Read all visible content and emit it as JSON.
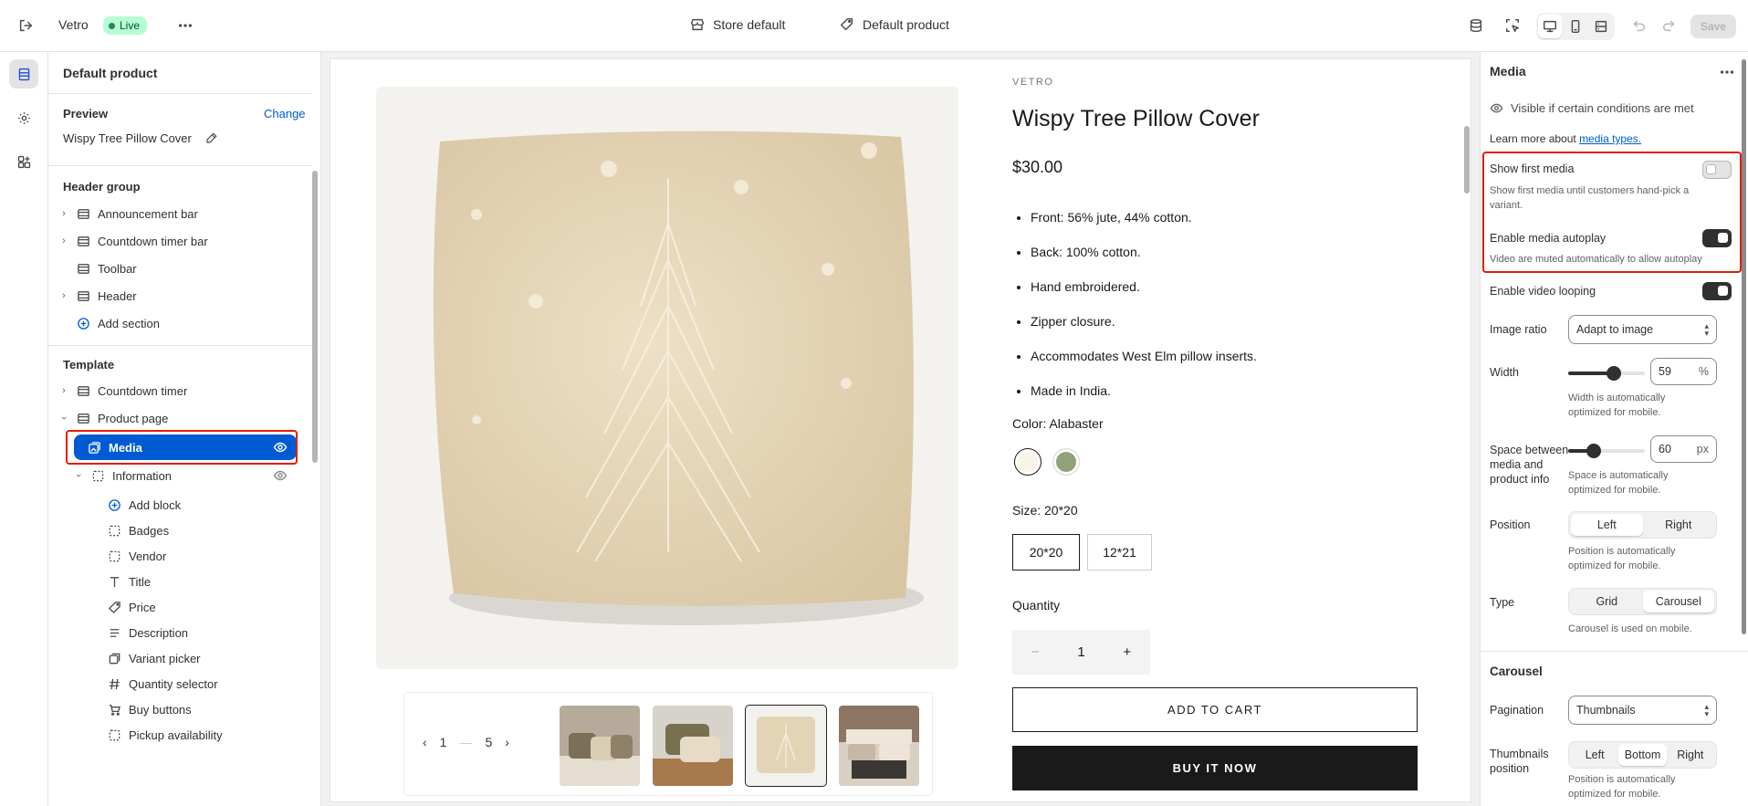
{
  "topbar": {
    "store_name": "Vetro",
    "live_label": "Live",
    "store_default_label": "Store default",
    "default_product_label": "Default product",
    "save_label": "Save"
  },
  "sidebar": {
    "title": "Default product",
    "preview_label": "Preview",
    "change_label": "Change",
    "preview_product": "Wispy Tree Pillow Cover",
    "header_group_label": "Header group",
    "header_items": [
      "Announcement bar",
      "Countdown timer bar",
      "Toolbar",
      "Header"
    ],
    "add_section_label": "Add section",
    "template_label": "Template",
    "template_items": [
      "Countdown timer",
      "Product page"
    ],
    "media_label": "Media",
    "information_label": "Information",
    "add_block_label": "Add block",
    "blocks": [
      "Badges",
      "Vendor",
      "Title",
      "Price",
      "Description",
      "Variant picker",
      "Quantity selector",
      "Buy buttons",
      "Pickup availability"
    ]
  },
  "product": {
    "vendor": "VETRO",
    "title": "Wispy Tree Pillow Cover",
    "price": "$30.00",
    "bullets": [
      "Front: 56% jute, 44% cotton.",
      "Back: 100% cotton.",
      "Hand embroidered.",
      "Zipper closure.",
      "Accommodates West Elm pillow inserts.",
      "Made in India."
    ],
    "color_label": "Color: Alabaster",
    "swatch_colors": [
      "#f8f5e6",
      "#8fa27a"
    ],
    "size_label": "Size: 20*20",
    "sizes": [
      "20*20",
      "12*21"
    ],
    "quantity_label": "Quantity",
    "quantity_value": "1",
    "minus": "−",
    "plus": "+",
    "add_to_cart": "ADD TO CART",
    "buy_now": "BUY IT NOW",
    "pager_current": "1",
    "pager_total": "5",
    "pager_sep": "—"
  },
  "settings": {
    "title": "Media",
    "visibility_text": "Visible if certain conditions are met",
    "learn_more_prefix": "Learn more about ",
    "learn_more_link": "media types.",
    "show_first_media_label": "Show first media",
    "show_first_media_help": "Show first media until customers hand-pick a variant.",
    "show_first_media_on": false,
    "autoplay_label": "Enable media autoplay",
    "autoplay_help": "Video are muted automatically to allow autoplay",
    "autoplay_on": true,
    "looping_label": "Enable video looping",
    "looping_on": true,
    "image_ratio_label": "Image ratio",
    "image_ratio_value": "Adapt to image",
    "width_label": "Width",
    "width_value": "59",
    "width_unit": "%",
    "width_help": "Width is automatically optimized for mobile.",
    "space_label": "Space between media and product info",
    "space_value": "60",
    "space_unit": "px",
    "space_help": "Space is automatically optimized for mobile.",
    "position_label": "Position",
    "position_options": [
      "Left",
      "Right"
    ],
    "position_help": "Position is automatically optimized for mobile.",
    "type_label": "Type",
    "type_options": [
      "Grid",
      "Carousel"
    ],
    "type_help": "Carousel is used on mobile.",
    "carousel_heading": "Carousel",
    "pagination_label": "Pagination",
    "pagination_value": "Thumbnails",
    "thumb_pos_label": "Thumbnails position",
    "thumb_pos_options": [
      "Left",
      "Bottom",
      "Right"
    ],
    "thumb_pos_help": "Position is automatically optimized for mobile."
  }
}
